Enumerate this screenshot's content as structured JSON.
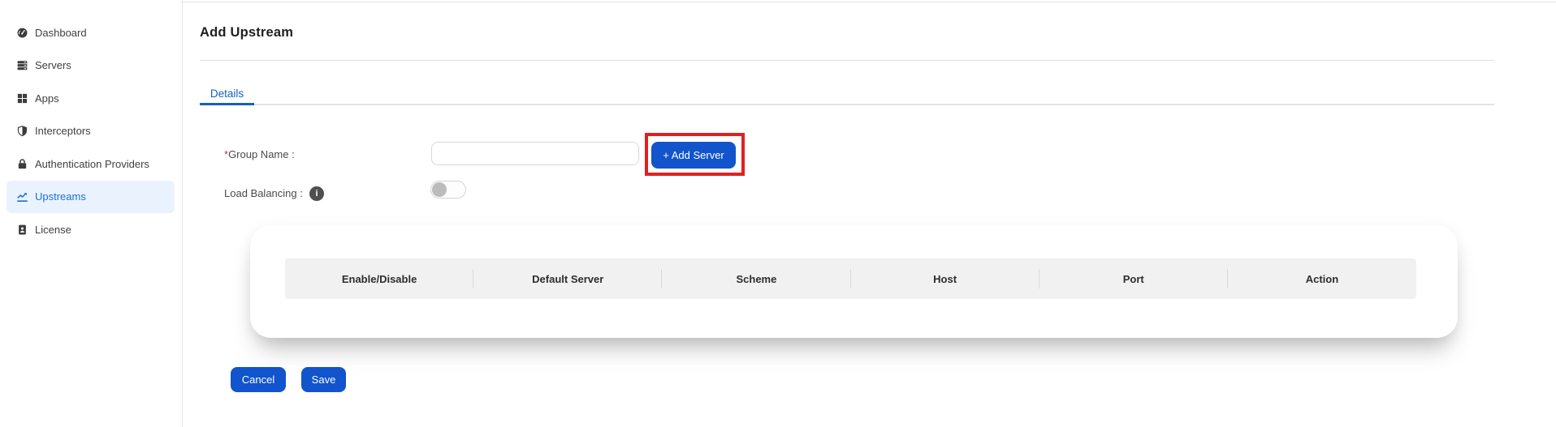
{
  "sidebar": {
    "items": [
      {
        "label": "Dashboard",
        "icon": "dashboard-gauge-icon",
        "active": false
      },
      {
        "label": "Servers",
        "icon": "servers-icon",
        "active": false
      },
      {
        "label": "Apps",
        "icon": "apps-grid-icon",
        "active": false
      },
      {
        "label": "Interceptors",
        "icon": "shield-icon",
        "active": false
      },
      {
        "label": "Authentication Providers",
        "icon": "lock-icon",
        "active": false
      },
      {
        "label": "Upstreams",
        "icon": "trend-chart-icon",
        "active": true
      },
      {
        "label": "License",
        "icon": "license-badge-icon",
        "active": false
      }
    ]
  },
  "header": {
    "title": "Add Upstream"
  },
  "tabs": {
    "details": {
      "label": "Details",
      "active": true
    }
  },
  "form": {
    "group_name": {
      "required_marker": "*",
      "label": "Group Name :",
      "value": "",
      "placeholder": ""
    },
    "add_server_button": {
      "label": "+ Add Server",
      "highlighted": true
    },
    "load_balancing": {
      "label": "Load Balancing :",
      "info_icon": "i",
      "enabled": false
    }
  },
  "table": {
    "columns": [
      "Enable/Disable",
      "Default Server",
      "Scheme",
      "Host",
      "Port",
      "Action"
    ],
    "rows": []
  },
  "actions": {
    "cancel_label": "Cancel",
    "save_label": "Save"
  },
  "colors": {
    "primary_blue": "#1154cc",
    "tab_blue": "#1360c4",
    "sidebar_active_blue": "#1a6fd8",
    "sidebar_active_bg": "#eaf3fd",
    "annotation_red": "#e02020",
    "table_header_bg": "#f1f1f1",
    "border_gray": "#e5e5e5"
  }
}
